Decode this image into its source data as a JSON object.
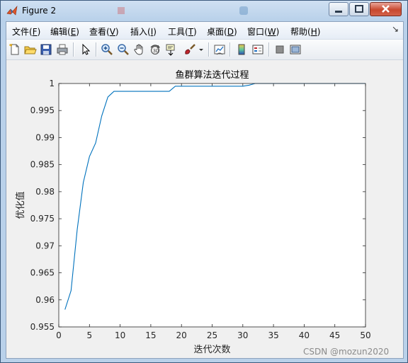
{
  "window": {
    "title": "Figure 2"
  },
  "menu": {
    "items": [
      {
        "text": "文件(",
        "key": "F",
        "end": ")"
      },
      {
        "text": "编辑(",
        "key": "E",
        "end": ")"
      },
      {
        "text": "查看(",
        "key": "V",
        "end": ")"
      },
      {
        "text": "插入(",
        "key": "I",
        "end": ")"
      },
      {
        "text": "工具(",
        "key": "T",
        "end": ")"
      },
      {
        "text": "桌面(",
        "key": "D",
        "end": ")"
      },
      {
        "text": "窗口(",
        "key": "W",
        "end": ")"
      },
      {
        "text": "帮助(",
        "key": "H",
        "end": ")"
      }
    ]
  },
  "toolbar": {
    "icons": [
      "new-figure-icon",
      "open-file-icon",
      "save-icon",
      "print-icon",
      "select-arrow-icon",
      "zoom-in-icon",
      "zoom-out-icon",
      "pan-hand-icon",
      "rotate-3d-icon",
      "data-cursor-icon",
      "brush-icon",
      "link-plot-icon",
      "colorbar-icon",
      "legend-icon",
      "hide-plot-tools-icon",
      "show-plot-tools-icon"
    ]
  },
  "chart_data": {
    "type": "line",
    "title": "鱼群算法迭代过程",
    "xlabel": "迭代次数",
    "ylabel": "优化值",
    "xlim": [
      0,
      50
    ],
    "ylim": [
      0.955,
      1
    ],
    "xticks": [
      "0",
      "5",
      "10",
      "15",
      "20",
      "25",
      "30",
      "35",
      "40",
      "45",
      "50"
    ],
    "yticks": [
      "0.955",
      "0.96",
      "0.965",
      "0.97",
      "0.975",
      "0.98",
      "0.985",
      "0.99",
      "0.995",
      "1"
    ],
    "grid": false,
    "line_color": "#0072bd",
    "series": [
      {
        "x": [
          1,
          2,
          3,
          4,
          5,
          6,
          7,
          8,
          9,
          10,
          11,
          12,
          13,
          14,
          15,
          16,
          17,
          18,
          19,
          20,
          21,
          22,
          23,
          24,
          25,
          26,
          27,
          28,
          29,
          30,
          31,
          32,
          33,
          34,
          35,
          36,
          37,
          38,
          39,
          40,
          41,
          42,
          43,
          44,
          45,
          46,
          47,
          48,
          49,
          50
        ],
        "values": [
          0.9582,
          0.9617,
          0.973,
          0.9817,
          0.9865,
          0.989,
          0.994,
          0.9975,
          0.99855,
          0.99855,
          0.99855,
          0.99855,
          0.99855,
          0.99855,
          0.99855,
          0.99855,
          0.99855,
          0.99855,
          0.9995,
          0.9995,
          0.9995,
          0.9995,
          0.9995,
          0.9995,
          0.9995,
          0.9995,
          0.9995,
          0.9995,
          0.9995,
          0.9995,
          0.99968,
          1.0,
          1.0,
          1.0,
          1.0,
          1.0,
          1.0,
          1.0,
          1.0,
          1.0,
          1.0,
          1.0,
          1.0,
          1.0,
          1.0,
          1.0,
          1.0,
          1.0,
          1.0,
          1.0
        ]
      }
    ]
  },
  "watermark": "CSDN @mozun2020"
}
